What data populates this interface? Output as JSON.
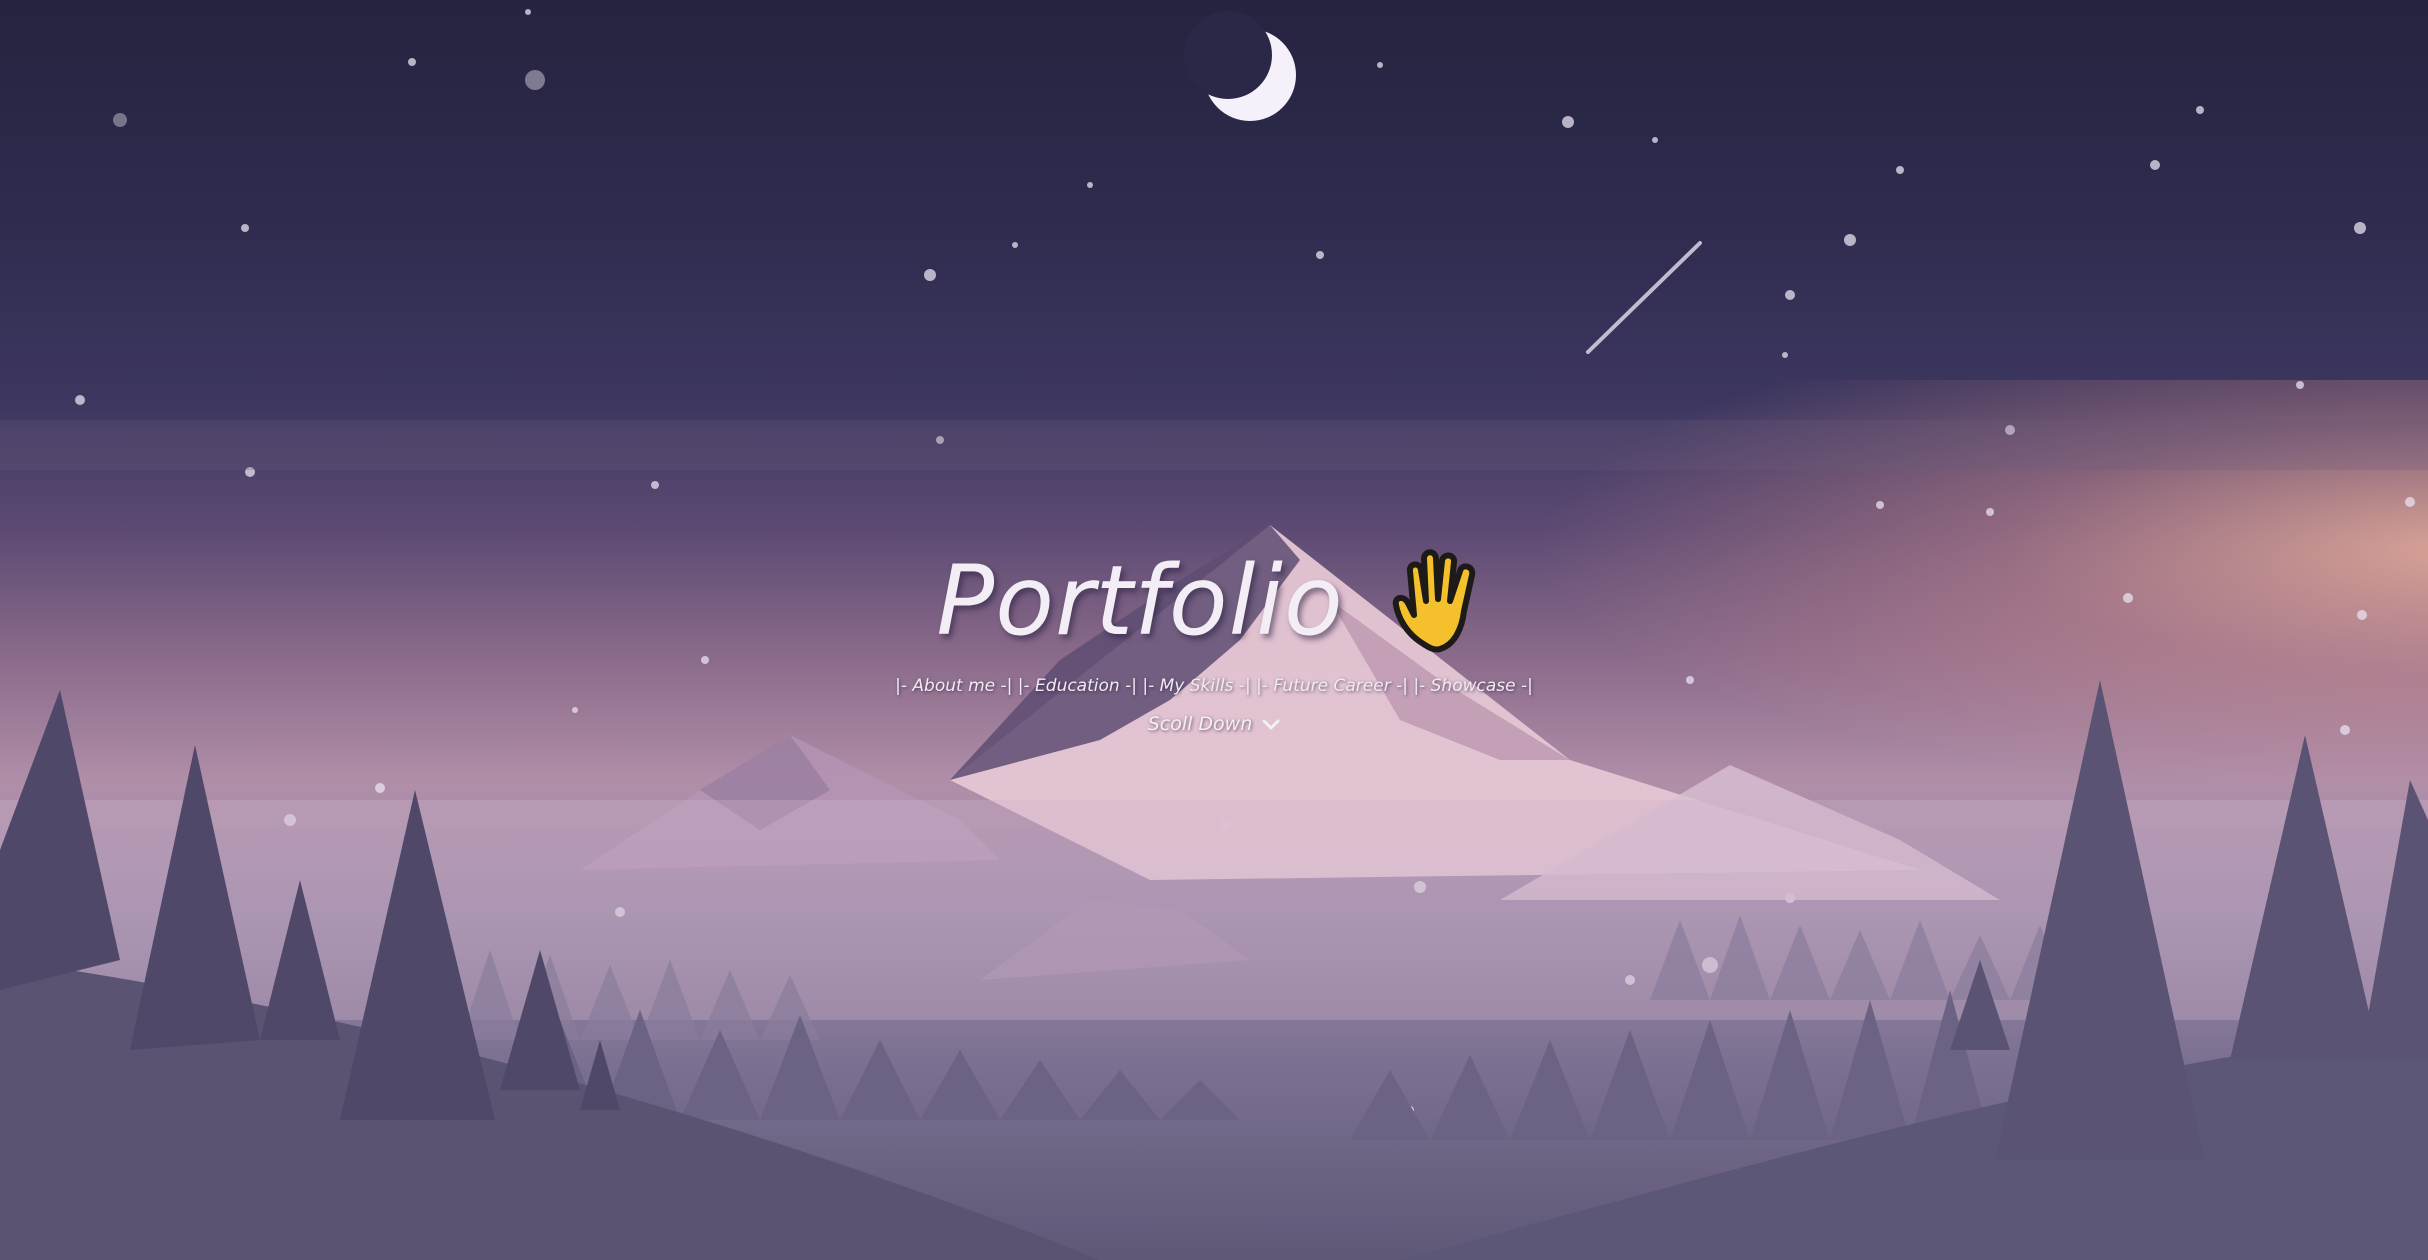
{
  "hero": {
    "title": "Portfolio",
    "wave_icon": "raised-hand-icon",
    "nav_items": [
      {
        "label": "|- About me -|"
      },
      {
        "label": "|- Education -|"
      },
      {
        "label": "|- My Skills -|"
      },
      {
        "label": "|- Future Career -|"
      },
      {
        "label": "|- Showcase -|"
      }
    ],
    "scroll_label": "Scoll Down",
    "scroll_icon": "chevron-down-icon"
  },
  "colors": {
    "sky_top": "#25233f",
    "horizon_glow": "#ffbea0",
    "mountain": "#d9b8c8",
    "trees": "#5b5373",
    "text": "#f3eef5"
  }
}
